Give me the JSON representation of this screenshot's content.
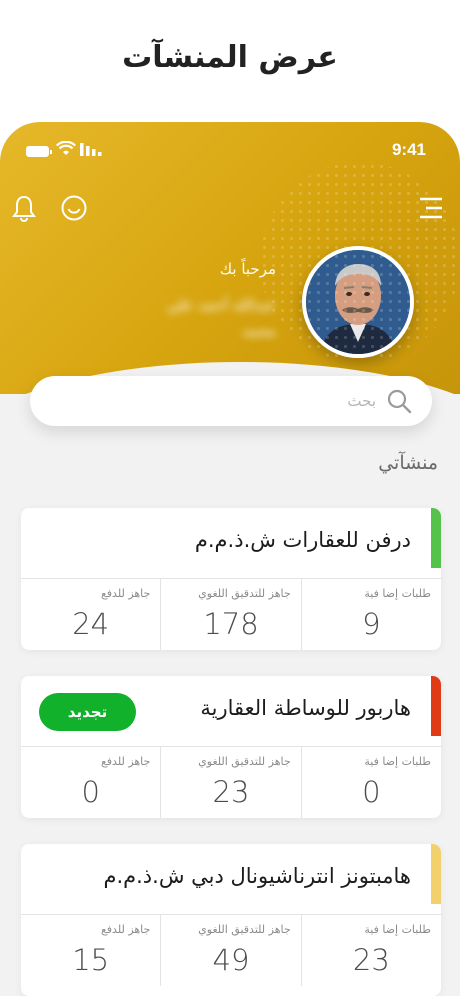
{
  "page_title": "عرض المنشآت",
  "status_bar": {
    "time": "9:41"
  },
  "header": {
    "welcome": "مرحباً بك",
    "user_name": "عبدالله أحمد علي محمد",
    "icons": [
      "menu-icon",
      "bell-icon",
      "smile-icon"
    ]
  },
  "search": {
    "placeholder": "بحث"
  },
  "section_title": "منشآتي",
  "colors": {
    "brand": "#d9a710",
    "renew": "#12b12b"
  },
  "facilities": [
    {
      "name": "درفن للعقارات ش.ذ.م.م",
      "status_color": "#55c24a",
      "renew_label": "",
      "stats": [
        {
          "label": "طلبات إضا فية",
          "value": "9"
        },
        {
          "label": "جاهز للتدقيق اللغوي",
          "value": "178"
        },
        {
          "label": "جاهز للدفع",
          "value": "24"
        }
      ]
    },
    {
      "name": "هاربور للوساطة العقارية",
      "status_color": "#e03b17",
      "renew_label": "تجديد",
      "stats": [
        {
          "label": "طلبات إضا فية",
          "value": "0"
        },
        {
          "label": "جاهز للتدقيق اللغوي",
          "value": "23"
        },
        {
          "label": "جاهز للدفع",
          "value": "0"
        }
      ]
    },
    {
      "name": "هامبتونز انترناشيونال دبي ش.ذ.م.م",
      "status_color": "#f2d06b",
      "renew_label": "",
      "stats": [
        {
          "label": "طلبات إضا فية",
          "value": "23"
        },
        {
          "label": "جاهز للتدقيق اللغوي",
          "value": "49"
        },
        {
          "label": "جاهز للدفع",
          "value": "15"
        }
      ]
    }
  ]
}
